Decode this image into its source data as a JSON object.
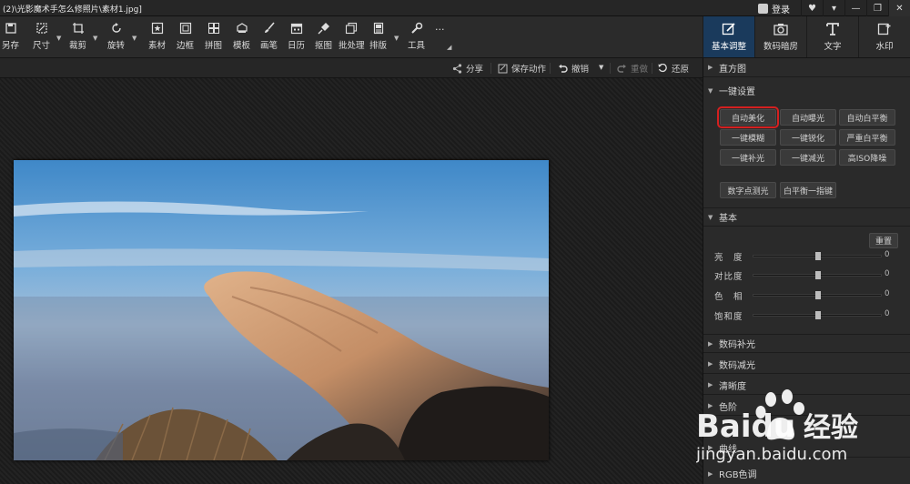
{
  "window": {
    "title": "(2)\\光影魔术手怎么修照片\\素材1.jpg]",
    "login_label": "登录",
    "controls": [
      "♥",
      "▾",
      "—",
      "❐",
      "✕"
    ]
  },
  "toolbar": [
    {
      "label": "另存",
      "icon": "save-icon"
    },
    {
      "label": "尺寸",
      "icon": "resize-icon"
    },
    {
      "label": "裁剪",
      "icon": "crop-icon"
    },
    {
      "label": "旋转",
      "icon": "rotate-icon"
    },
    {
      "label": "素材",
      "icon": "star-icon"
    },
    {
      "label": "边框",
      "icon": "frame-icon"
    },
    {
      "label": "拼图",
      "icon": "grid-icon"
    },
    {
      "label": "模板",
      "icon": "template-icon"
    },
    {
      "label": "画笔",
      "icon": "brush-icon"
    },
    {
      "label": "日历",
      "icon": "calendar-icon"
    },
    {
      "label": "抠图",
      "icon": "cutout-icon"
    },
    {
      "label": "批处理",
      "icon": "batch-icon"
    },
    {
      "label": "排版",
      "icon": "layout-icon"
    },
    {
      "label": "工具",
      "icon": "wrench-icon"
    },
    {
      "label": "···",
      "icon": "more-icon"
    }
  ],
  "right_tabs": [
    {
      "label": "基本调整",
      "icon": "adjust-icon",
      "active": true
    },
    {
      "label": "数码暗房",
      "icon": "camera-icon",
      "active": false
    },
    {
      "label": "文字",
      "icon": "text-icon",
      "active": false
    },
    {
      "label": "水印",
      "icon": "watermark-icon",
      "active": false
    }
  ],
  "actions": {
    "share": "分享",
    "save_action": "保存动作",
    "undo": "撤销",
    "redo": "重做",
    "restore": "还原"
  },
  "panel": {
    "histogram": "直方图",
    "one_click": "一键设置",
    "buttons": [
      [
        "自动美化",
        "自动曝光",
        "自动白平衡"
      ],
      [
        "一键模糊",
        "一键锐化",
        "严重白平衡"
      ],
      [
        "一键补光",
        "一键减光",
        "高ISO降噪"
      ]
    ],
    "extra_buttons": [
      "数字点测光",
      "白平衡一指键"
    ],
    "basic": "基本",
    "reset": "重置",
    "sliders": [
      {
        "label": "亮　度",
        "value": "0",
        "level": 0.5
      },
      {
        "label": "对比度",
        "value": "0",
        "level": 0.5
      },
      {
        "label": "色　相",
        "value": "0",
        "level": 0.5
      },
      {
        "label": "饱和度",
        "value": "0",
        "level": 0.5
      }
    ],
    "collapsed": [
      "数码补光",
      "数码减光",
      "清晰度",
      "色阶",
      "曲线",
      "RGB色调"
    ]
  },
  "watermark": {
    "brand": "Baidu",
    "brand_cn": "经验",
    "url": "jingyan.baidu.com"
  },
  "colors": {
    "highlight": "#d42020",
    "active_tab": "#1a3a5c"
  }
}
